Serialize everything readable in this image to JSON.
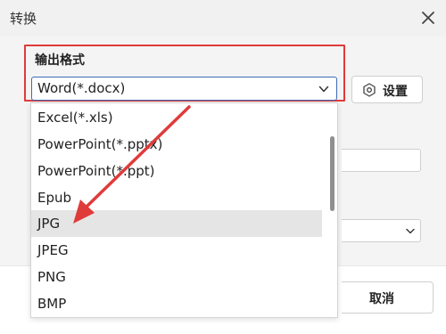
{
  "window": {
    "title": "转换",
    "close_icon": "close-icon"
  },
  "output_format": {
    "label": "输出格式",
    "selected_value": "Word(*.docx)",
    "options": [
      "Excel(*.xls)",
      "PowerPoint(*.pptx)",
      "PowerPoint(*.ppt)",
      "Epub",
      "JPG",
      "JPEG",
      "PNG",
      "BMP"
    ],
    "hovered_option": "JPG"
  },
  "settings_button": {
    "label": "设置",
    "icon": "gear-icon"
  },
  "footer": {
    "cancel_label": "取消"
  },
  "colors": {
    "annotation_red": "#e03b3b",
    "select_border_blue": "#3d6ab6",
    "hover_gray": "#e5e5e5"
  }
}
